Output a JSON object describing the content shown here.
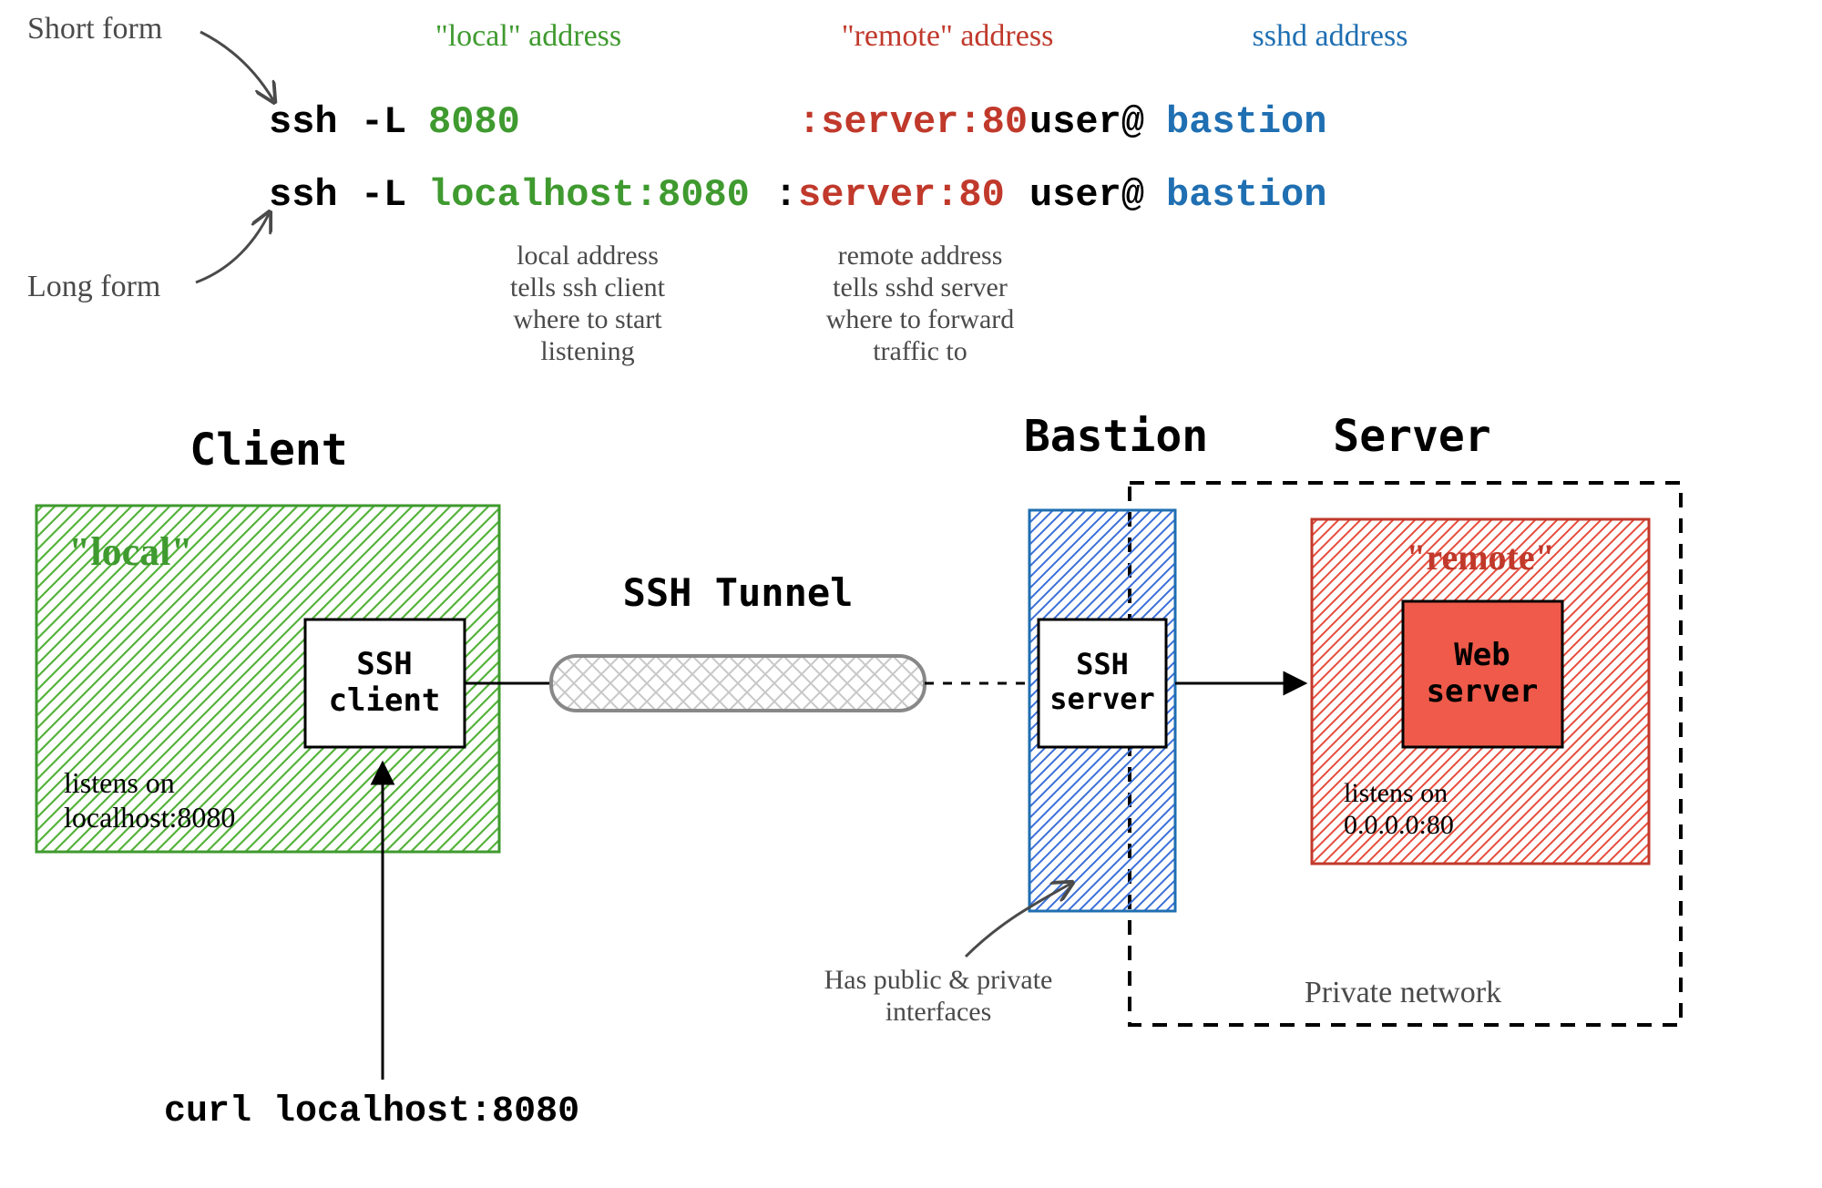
{
  "colors": {
    "black": "#000000",
    "gray": "#4a4a4a",
    "green": "#3f9a2f",
    "red": "#c0392b",
    "blue": "#1f6fb2",
    "greenHatch": "#55b33b",
    "blueHatch": "#3a6fd8",
    "redHatch": "#e74c3c",
    "redFill": "#ef5a4a",
    "tunnel": "#c8c8c8"
  },
  "top": {
    "shortFormLabel": "Short form",
    "longFormLabel": "Long form",
    "labels": {
      "localAddr": "\"local\" address",
      "remoteAddr": "\"remote\" address",
      "sshdAddr": "sshd address"
    },
    "short": {
      "cmd": "ssh -L ",
      "localPort": "8080",
      "remoteSep": ":",
      "remote": "server:80",
      "userSep": " user@",
      "host": "bastion"
    },
    "long": {
      "cmd": "ssh -L ",
      "local": "localhost:8080",
      "remoteSep": ":",
      "remote": "server:80",
      "userSep": " user@",
      "host": "bastion"
    },
    "notes": {
      "localNote1": "local address",
      "localNote2": "tells ssh client",
      "localNote3": "where to start",
      "localNote4": "listening",
      "remoteNote1": "remote address",
      "remoteNote2": "tells sshd server",
      "remoteNote3": "where to forward",
      "remoteNote4": "traffic to"
    }
  },
  "diagram": {
    "titles": {
      "client": "Client",
      "bastion": "Bastion",
      "server": "Server"
    },
    "clientBox": {
      "localLabel": "\"local\"",
      "sshClient1": "SSH",
      "sshClient2": "client",
      "listens1": "listens on",
      "listens2": "localhost:8080"
    },
    "tunnelLabel": "SSH Tunnel",
    "bastionBox": {
      "sshServer1": "SSH",
      "sshServer2": "server"
    },
    "serverBox": {
      "remoteLabel": "\"remote\"",
      "web1": "Web",
      "web2": "server",
      "listens1": "listens on",
      "listens2": "0.0.0.0:80"
    },
    "privateNetwork": "Private network",
    "bastionNote1": "Has public & private",
    "bastionNote2": "interfaces",
    "curlCmd": "curl localhost:8080"
  }
}
